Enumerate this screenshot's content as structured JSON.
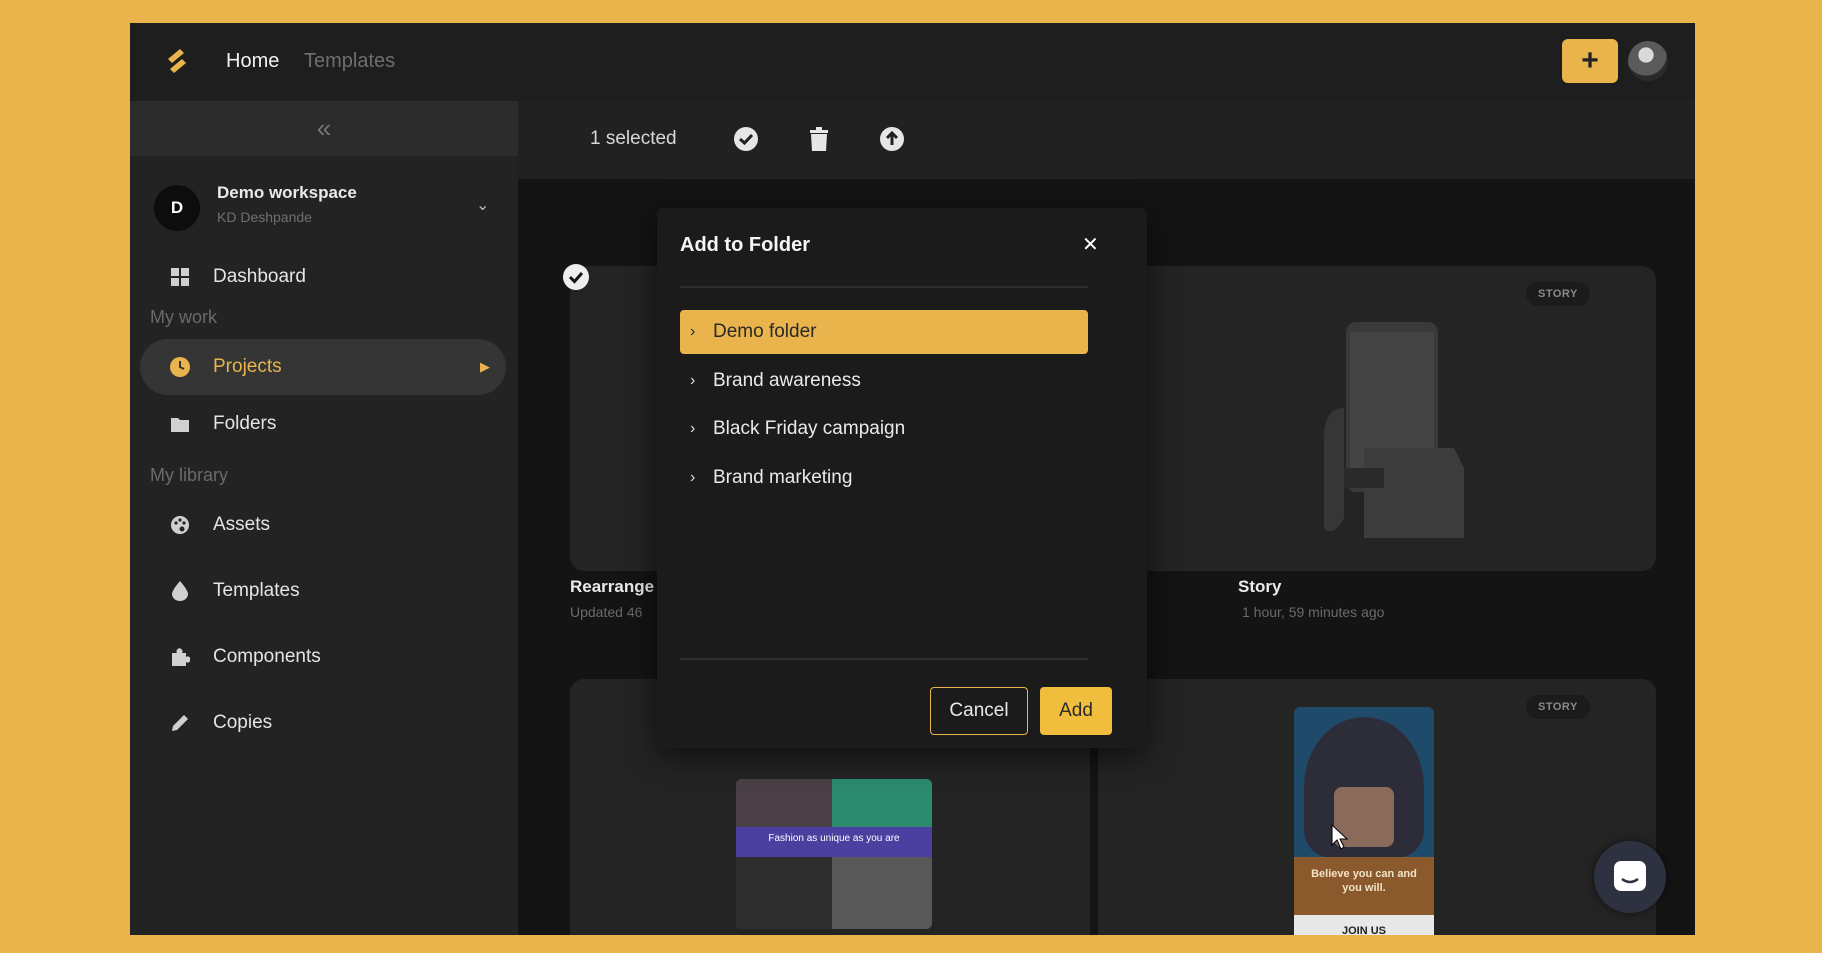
{
  "topbar": {
    "nav": [
      {
        "label": "Home"
      },
      {
        "label": "Templates"
      }
    ],
    "add_button_label": "+"
  },
  "sidebar": {
    "collapse_label": "«",
    "workspace": {
      "initial": "D",
      "name": "Demo workspace",
      "user": "KD Deshpande"
    },
    "dashboard_label": "Dashboard",
    "sections": [
      {
        "title": "My work"
      },
      {
        "title": "My library"
      }
    ],
    "items": [
      {
        "label": "Projects",
        "icon": "clock-icon"
      },
      {
        "label": "Folders",
        "icon": "folder-icon"
      },
      {
        "label": "Assets",
        "icon": "palette-icon"
      },
      {
        "label": "Templates",
        "icon": "drop-icon"
      },
      {
        "label": "Components",
        "icon": "puzzle-icon"
      },
      {
        "label": "Copies",
        "icon": "pencil-icon"
      }
    ]
  },
  "actionbar": {
    "selected_text": "1 selected"
  },
  "cards": [
    {
      "title": "Rearrange",
      "subtitle": "Updated 46"
    },
    {
      "title": "Story",
      "subtitle": "1 hour, 59 minutes ago",
      "badge": "STORY"
    },
    {
      "badge": "STORY",
      "thumb_text": "Fashion as unique as you are",
      "promo_text": "Believe you can and you will.",
      "cta": "JOIN US"
    }
  ],
  "modal": {
    "title": "Add to Folder",
    "close_label": "✕",
    "folders": [
      {
        "name": "Demo folder",
        "selected": true
      },
      {
        "name": "Brand awareness"
      },
      {
        "name": "Black Friday campaign"
      },
      {
        "name": "Brand marketing"
      }
    ],
    "cancel_label": "Cancel",
    "add_label": "Add"
  },
  "colors": {
    "accent": "#E9B44C",
    "background": "#1c1c1c",
    "page_border": "#E9B44C"
  }
}
